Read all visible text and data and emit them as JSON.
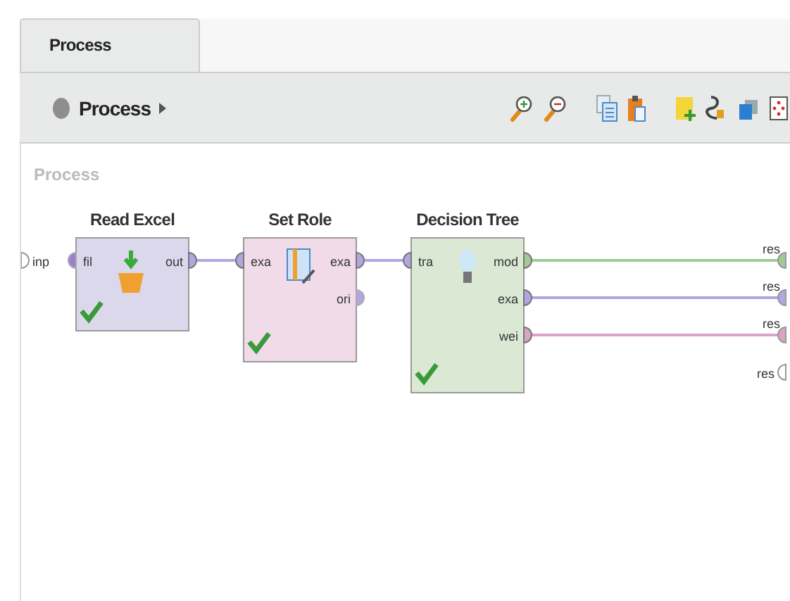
{
  "tabs": [
    {
      "label": "Process",
      "selected": true
    }
  ],
  "toolbar": {
    "breadcrumb": "Process"
  },
  "canvas": {
    "title": "Process",
    "process_input": {
      "label": "inp",
      "connected": false
    },
    "operators": [
      {
        "name": "Read Excel",
        "kind": "reader",
        "color": "#dcd8eb",
        "executed": true,
        "inputs": [
          {
            "label": "fil",
            "color": "#9b7fd0",
            "connected": false
          }
        ],
        "outputs": [
          {
            "label": "out",
            "color": "#b3a6e0",
            "connected": true
          }
        ]
      },
      {
        "name": "Set Role",
        "kind": "role",
        "color": "#f1dbe9",
        "executed": true,
        "inputs": [
          {
            "label": "exa",
            "color": "#b3a6e0",
            "connected": true
          }
        ],
        "outputs": [
          {
            "label": "exa",
            "color": "#b3a6e0",
            "connected": true
          },
          {
            "label": "ori",
            "color": "#b3a6e0",
            "connected": false
          }
        ]
      },
      {
        "name": "Decision Tree",
        "kind": "learner",
        "color": "#dbe9d4",
        "executed": true,
        "inputs": [
          {
            "label": "tra",
            "color": "#b3a6e0",
            "connected": true
          }
        ],
        "outputs": [
          {
            "label": "mod",
            "color": "#a3c997",
            "connected": true
          },
          {
            "label": "exa",
            "color": "#b3a6e0",
            "connected": true
          },
          {
            "label": "wei",
            "color": "#dba3c6",
            "connected": true
          }
        ]
      }
    ],
    "results": [
      {
        "label": "res",
        "connected": true
      },
      {
        "label": "res",
        "connected": true
      },
      {
        "label": "res",
        "connected": true
      },
      {
        "label": "res",
        "connected": false
      }
    ]
  }
}
